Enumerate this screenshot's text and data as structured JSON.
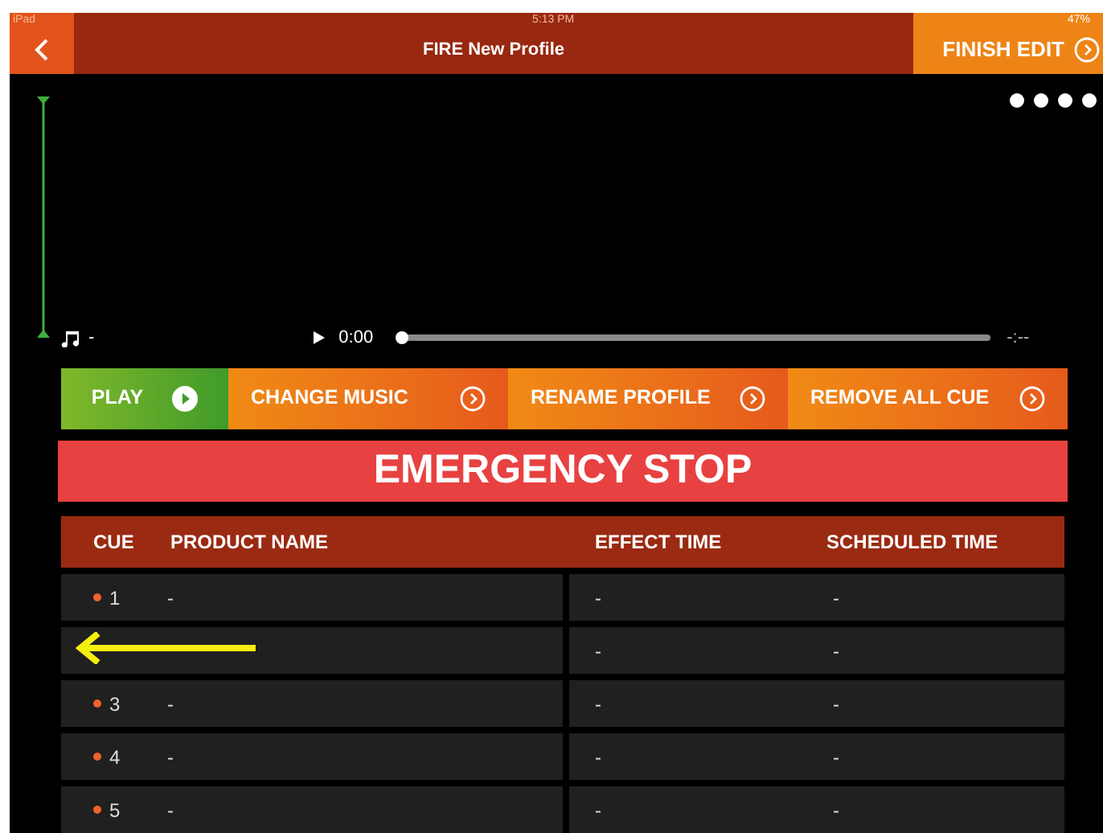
{
  "status_bar": {
    "device": "iPad",
    "time": "5:13 PM",
    "battery": "47%"
  },
  "nav": {
    "title": "FIRE New Profile",
    "action": "FINISH EDIT"
  },
  "player": {
    "track": "-",
    "elapsed": "0:00",
    "level": 0,
    "remaining": "-:--"
  },
  "actions": [
    {
      "label": "PLAY",
      "kind": "play"
    },
    {
      "label": "CHANGE MUSIC",
      "kind": "more"
    },
    {
      "label": "RENAME PROFILE",
      "kind": "more"
    },
    {
      "label": "REMOVE ALL CUE",
      "kind": "more"
    }
  ],
  "emergency": "EMERGENCY STOP",
  "table": {
    "columns": [
      "CUE",
      "PRODUCT NAME",
      "EFFECT TIME",
      "SCHEDULED TIME"
    ],
    "rows": [
      {
        "cue": "1",
        "product": "-",
        "effect": "-",
        "scheduled": "-"
      },
      {
        "effect": "-",
        "scheduled": "-"
      },
      {
        "cue": "3",
        "product": "-",
        "effect": "-",
        "scheduled": "-"
      },
      {
        "cue": "4",
        "product": "-",
        "effect": "-",
        "scheduled": "-"
      },
      {
        "cue": "5",
        "product": "-",
        "effect": "-",
        "scheduled": "-"
      }
    ]
  }
}
